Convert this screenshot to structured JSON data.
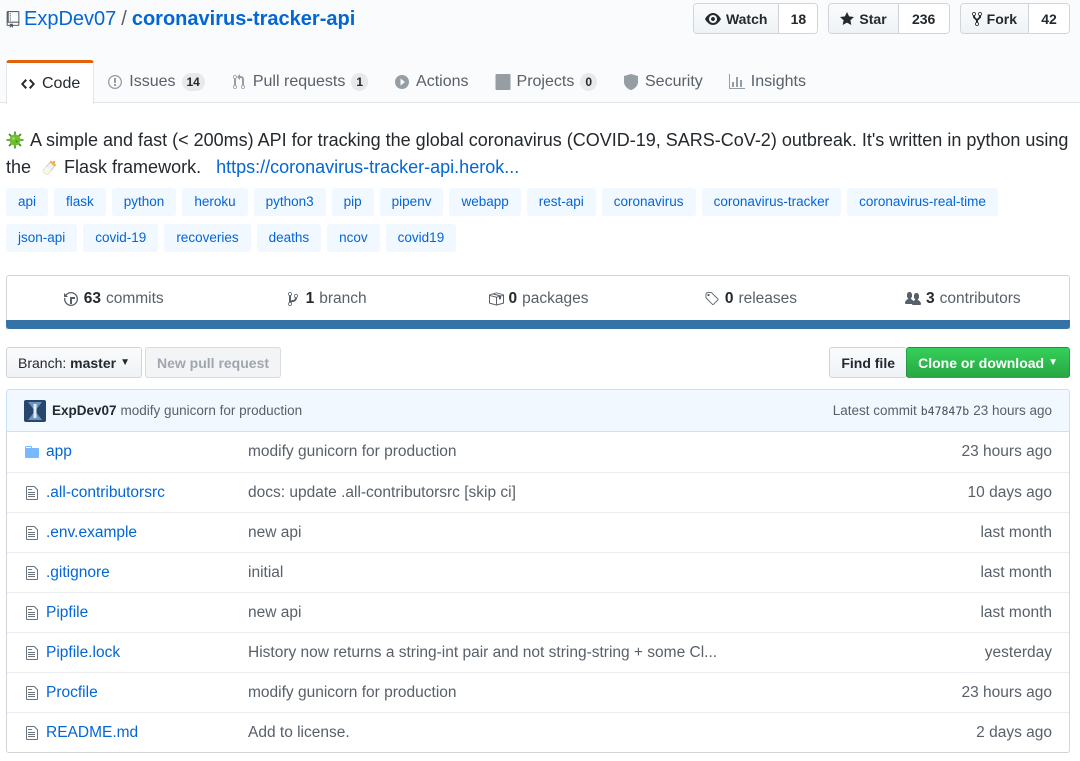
{
  "repo": {
    "owner": "ExpDev07",
    "separator": "/",
    "name": "coronavirus-tracker-api"
  },
  "actions": {
    "watch": {
      "label": "Watch",
      "count": "18"
    },
    "star": {
      "label": "Star",
      "count": "236"
    },
    "fork": {
      "label": "Fork",
      "count": "42"
    }
  },
  "tabs": [
    {
      "label": "Code",
      "icon": "code-icon",
      "selected": true
    },
    {
      "label": "Issues",
      "counter": "14",
      "icon": "issue-icon"
    },
    {
      "label": "Pull requests",
      "counter": "1",
      "icon": "pull-request-icon"
    },
    {
      "label": "Actions",
      "icon": "play-icon"
    },
    {
      "label": "Projects",
      "counter": "0",
      "icon": "project-icon"
    },
    {
      "label": "Security",
      "icon": "shield-icon"
    },
    {
      "label": "Insights",
      "icon": "graph-icon"
    }
  ],
  "description": {
    "text_before": "A simple and fast (< 200ms) API for tracking the global coronavirus (COVID-19, SARS-CoV-2) outbreak. It's written in python using the",
    "text_after": "Flask framework.",
    "homepage": "https://coronavirus-tracker-api.herok..."
  },
  "topics": [
    "api",
    "flask",
    "python",
    "heroku",
    "python3",
    "pip",
    "pipenv",
    "webapp",
    "rest-api",
    "coronavirus",
    "coronavirus-tracker",
    "coronavirus-real-time",
    "json-api",
    "covid-19",
    "recoveries",
    "deaths",
    "ncov",
    "covid19"
  ],
  "summary": {
    "commits": {
      "count": "63",
      "label": "commits"
    },
    "branch": {
      "count": "1",
      "label": "branch"
    },
    "packages": {
      "count": "0",
      "label": "packages"
    },
    "releases": {
      "count": "0",
      "label": "releases"
    },
    "contributors": {
      "count": "3",
      "label": "contributors"
    },
    "language_color": "#3572A5"
  },
  "toolbar": {
    "branch_prefix": "Branch:",
    "branch_name": "master",
    "new_pr": "New pull request",
    "find_file": "Find file",
    "clone": "Clone or download"
  },
  "latest_commit": {
    "author": "ExpDev07",
    "message": "modify gunicorn for production",
    "prefix": "Latest commit",
    "sha": "b47847b",
    "age": "23 hours ago"
  },
  "files": [
    {
      "type": "dir",
      "name": "app",
      "message": "modify gunicorn for production",
      "age": "23 hours ago"
    },
    {
      "type": "file",
      "name": ".all-contributorsrc",
      "message": "docs: update .all-contributorsrc [skip ci]",
      "age": "10 days ago"
    },
    {
      "type": "file",
      "name": ".env.example",
      "message": "new api",
      "age": "last month"
    },
    {
      "type": "file",
      "name": ".gitignore",
      "message": "initial",
      "age": "last month"
    },
    {
      "type": "file",
      "name": "Pipfile",
      "message": "new api",
      "age": "last month"
    },
    {
      "type": "file",
      "name": "Pipfile.lock",
      "message": "History now returns a string-int pair and not string-string + some Cl...",
      "age": "yesterday"
    },
    {
      "type": "file",
      "name": "Procfile",
      "message": "modify gunicorn for production",
      "age": "23 hours ago"
    },
    {
      "type": "file",
      "name": "README.md",
      "message": "Add to license.",
      "age": "2 days ago"
    }
  ]
}
